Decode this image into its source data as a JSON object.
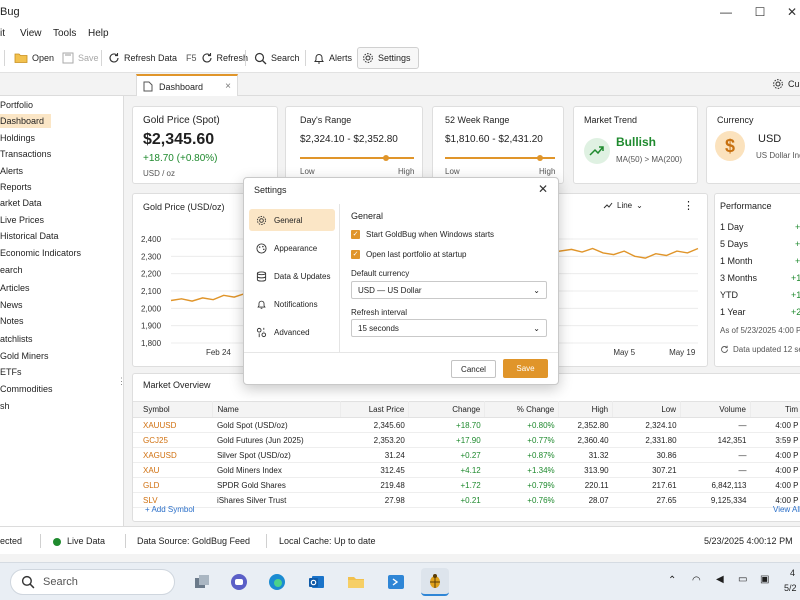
{
  "window": {
    "title": "Bug",
    "controls": {
      "minimize": "—",
      "maximize": "☐",
      "close": "✕"
    }
  },
  "menu": [
    "it",
    "View",
    "Tools",
    "Help"
  ],
  "toolbar": {
    "open": "Open",
    "save": "Save",
    "refresh_data": "Refresh Data",
    "f5": "F5",
    "refresh": "Refresh",
    "search": "Search",
    "alerts": "Alerts",
    "settings": "Settings"
  },
  "tabs": {
    "dashboard": "Dashboard",
    "close": "×",
    "customize": "Cu"
  },
  "sidebar": {
    "items": [
      {
        "label": "Portfolio"
      },
      {
        "label": "Dashboard",
        "selected": true
      },
      {
        "label": "Holdings"
      },
      {
        "label": "Transactions"
      },
      {
        "label": "Alerts"
      },
      {
        "label": "Reports"
      },
      {
        "label": "arket Data"
      },
      {
        "label": "Live Prices"
      },
      {
        "label": "Historical Data"
      },
      {
        "label": "Economic Indicators"
      },
      {
        "label": "earch"
      },
      {
        "label": "Articles"
      },
      {
        "label": "News"
      },
      {
        "label": "Notes"
      },
      {
        "label": "atchlists"
      },
      {
        "label": "Gold Miners"
      },
      {
        "label": "ETFs"
      },
      {
        "label": "Commodities"
      },
      {
        "label": "sh"
      }
    ],
    "grip": "⋮"
  },
  "cards": {
    "gold_price": {
      "title": "Gold Price (Spot)",
      "value": "$2,345.60",
      "change": "+18.70  (+0.80%)",
      "unit": "USD / oz"
    },
    "days_range": {
      "title": "Day's Range",
      "range": "$2,324.10  -  $2,352.80",
      "low": "Low",
      "high": "High",
      "position": 0.75
    },
    "week52_range": {
      "title": "52 Week Range",
      "range": "$1,810.60  -  $2,431.20",
      "low": "Low",
      "high": "High",
      "position": 0.86
    },
    "market_trend": {
      "title": "Market Trend",
      "value": "Bullish",
      "detail": "MA(50) > MA(200)"
    },
    "currency": {
      "title": "Currency",
      "value": "USD",
      "detail": "US Dollar Inde",
      "symbol": "$"
    }
  },
  "chart_card": {
    "title": "Gold Price  (USD/oz)",
    "type_label": "Line",
    "more": "⋮"
  },
  "chart_data": {
    "type": "line",
    "title": "Gold Price  (USD/oz)",
    "ylim": [
      1800,
      2400
    ],
    "yticks": [
      "2,400",
      "2,300",
      "2,200",
      "2,100",
      "2,000",
      "1,900",
      "1,800"
    ],
    "xticks": [
      {
        "label": "Feb 24",
        "x": 0.09
      },
      {
        "label": "May 5",
        "x": 0.86
      },
      {
        "label": "May 19",
        "x": 0.97
      }
    ],
    "series": [
      {
        "color": "#e0952a",
        "x": [
          0.0,
          0.02,
          0.04,
          0.06,
          0.08,
          0.1,
          0.12,
          0.14,
          0.16,
          0.18,
          0.2,
          0.22,
          0.24,
          0.26,
          0.28,
          0.3,
          0.32,
          0.34,
          0.36,
          0.76,
          0.78,
          0.8,
          0.82,
          0.84,
          0.86,
          0.88,
          0.9,
          0.92,
          0.94,
          0.96,
          0.98,
          1.0
        ],
        "y": [
          2045,
          2055,
          2042,
          2060,
          2050,
          2075,
          2065,
          2085,
          2070,
          2095,
          2088,
          2110,
          2100,
          2125,
          2118,
          2140,
          2132,
          2150,
          2160,
          2340,
          2325,
          2345,
          2320,
          2310,
          2330,
          2300,
          2290,
          2315,
          2305,
          2330,
          2320,
          2345
        ]
      }
    ]
  },
  "performance": {
    "title": "Performance",
    "rows": [
      {
        "label": "1 Day",
        "value": "+"
      },
      {
        "label": "5 Days",
        "value": "+"
      },
      {
        "label": "1 Month",
        "value": "+"
      },
      {
        "label": "3 Months",
        "value": "+1"
      },
      {
        "label": "YTD",
        "value": "+1"
      },
      {
        "label": "1 Year",
        "value": "+2"
      }
    ],
    "as_of": "As of 5/23/2025 4:00 PM",
    "updated": "Data updated 12 sec"
  },
  "market_overview": {
    "title": "Market Overview",
    "columns": [
      "Symbol",
      "Name",
      "Last Price",
      "Change",
      "% Change",
      "High",
      "Low",
      "Volume",
      "Tim"
    ],
    "rows": [
      [
        "XAUUSD",
        "Gold Spot (USD/oz)",
        "2,345.60",
        "+18.70",
        "+0.80%",
        "2,352.80",
        "2,324.10",
        "—",
        "4:00 P"
      ],
      [
        "GCJ25",
        "Gold Futures (Jun 2025)",
        "2,353.20",
        "+17.90",
        "+0.77%",
        "2,360.40",
        "2,331.80",
        "142,351",
        "3:59 P"
      ],
      [
        "XAGUSD",
        "Silver Spot (USD/oz)",
        "31.24",
        "+0.27",
        "+0.87%",
        "31.32",
        "30.86",
        "—",
        "4:00 P"
      ],
      [
        "XAU",
        "Gold Miners Index",
        "312.45",
        "+4.12",
        "+1.34%",
        "313.90",
        "307.21",
        "—",
        "4:00 P"
      ],
      [
        "GLD",
        "SPDR Gold Shares",
        "219.48",
        "+1.72",
        "+0.79%",
        "220.11",
        "217.61",
        "6,842,113",
        "4:00 P"
      ],
      [
        "SLV",
        "iShares Silver Trust",
        "27.98",
        "+0.21",
        "+0.76%",
        "28.07",
        "27.65",
        "9,125,334",
        "4:00 P"
      ]
    ],
    "add_symbol": "+ Add Symbol",
    "view_all": "View All"
  },
  "statusbar": {
    "connected": "ected",
    "live": "Live Data",
    "source": "Data Source: GoldBug Feed",
    "cache": "Local Cache: Up to date",
    "datetime": "5/23/2025  4:00:12 PM"
  },
  "taskbar": {
    "search": "Search",
    "time": "4",
    "date": "5/2"
  },
  "settings_dialog": {
    "title": "Settings",
    "close": "✕",
    "nav": [
      "General",
      "Appearance",
      "Data & Updates",
      "Notifications",
      "Advanced"
    ],
    "section_title": "General",
    "check_start": "Start GoldBug when Windows starts",
    "check_open_last": "Open last portfolio at startup",
    "currency_label": "Default currency",
    "currency_value": "USD — US Dollar",
    "refresh_label": "Refresh interval",
    "refresh_value": "15 seconds",
    "cancel": "Cancel",
    "save": "Save"
  }
}
